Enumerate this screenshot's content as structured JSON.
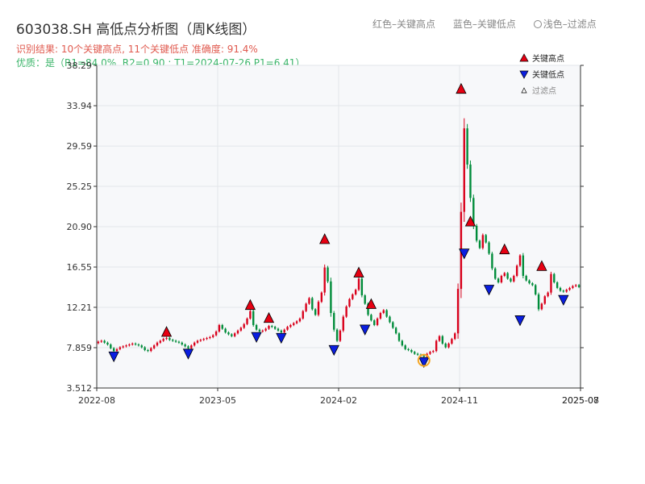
{
  "title": "603038.SH 高低点分析图（周K线图）",
  "subtitle1": "识别结果: 10个关键高点, 11个关键低点  准确度: 91.4%",
  "subtitle2": "优质：是（R1=84.0%, R2=0.90 ; T1=2024-07-26 P1=6.41）",
  "top_legend": {
    "red_label": "红色–关键高点",
    "blue_label": "蓝色–关键低点",
    "light_label": "浅色–过滤点"
  },
  "colors": {
    "up": "#d9001b",
    "down": "#008c3a",
    "high_marker": "#e60012",
    "low_marker": "#0a1ee0",
    "filtered": "#f5a623",
    "plot_bg": "#f7f8fa",
    "grid": "#e3e6ea"
  },
  "chart_data": {
    "type": "candlestick",
    "ylim": [
      3.512,
      38.29
    ],
    "yticks": [
      "3.512",
      "7.859",
      "12.21",
      "16.55",
      "20.90",
      "25.25",
      "29.59",
      "33.94",
      "38.29"
    ],
    "xlim_weeks": [
      0,
      156
    ],
    "xticks": [
      {
        "week": 0,
        "label": "2022-08"
      },
      {
        "week": 39,
        "label": "2023-05"
      },
      {
        "week": 78,
        "label": "2024-02"
      },
      {
        "week": 117,
        "label": "2024-11"
      },
      {
        "week": 156,
        "label": "2025-07"
      },
      {
        "week": 156,
        "label": "2025-08"
      }
    ],
    "legend": [
      {
        "label": "关键高点",
        "marker": "up-triangle"
      },
      {
        "label": "关键低点",
        "marker": "down-triangle"
      },
      {
        "label": "过滤点",
        "marker": "small-triangle"
      }
    ],
    "closes": [
      8.5,
      8.6,
      8.4,
      8.2,
      7.8,
      7.5,
      7.7,
      7.9,
      8.0,
      8.1,
      8.2,
      8.3,
      8.2,
      8.1,
      7.9,
      7.6,
      7.5,
      7.8,
      8.1,
      8.4,
      8.6,
      8.8,
      8.9,
      8.7,
      8.6,
      8.5,
      8.4,
      8.2,
      8.0,
      7.8,
      8.1,
      8.4,
      8.6,
      8.7,
      8.8,
      8.9,
      9.0,
      9.2,
      9.6,
      10.3,
      9.9,
      9.5,
      9.3,
      9.1,
      9.4,
      9.7,
      10.0,
      10.4,
      11.0,
      11.8,
      10.3,
      9.8,
      9.6,
      9.7,
      9.9,
      10.2,
      10.1,
      9.9,
      9.7,
      9.5,
      9.8,
      10.1,
      10.3,
      10.5,
      10.7,
      11.0,
      11.8,
      12.6,
      13.2,
      12.0,
      11.4,
      12.8,
      13.8,
      16.5,
      15.0,
      11.6,
      9.8,
      8.6,
      9.7,
      11.2,
      12.3,
      13.1,
      13.6,
      14.1,
      15.3,
      13.5,
      12.6,
      11.4,
      10.8,
      10.3,
      11.0,
      11.6,
      11.9,
      11.2,
      10.6,
      10.0,
      9.4,
      8.6,
      8.1,
      7.7,
      7.6,
      7.4,
      7.2,
      7.1,
      7.0,
      6.9,
      7.2,
      7.4,
      7.5,
      8.6,
      9.1,
      8.3,
      7.9,
      8.3,
      8.8,
      9.4,
      14.2,
      22.5,
      31.5,
      27.6,
      24.0,
      21.0,
      19.4,
      18.6,
      20.0,
      19.2,
      18.0,
      16.4,
      15.3,
      14.9,
      15.6,
      15.9,
      15.3,
      15.0,
      15.6,
      16.7,
      17.8,
      15.6,
      15.1,
      14.8,
      14.6,
      13.6,
      12.0,
      12.6,
      13.4,
      13.8,
      15.8,
      14.9,
      14.3,
      14.0,
      13.9,
      14.1,
      14.3,
      14.5,
      14.6,
      14.4
    ],
    "key_highs": [
      {
        "week": 22,
        "value": 8.9
      },
      {
        "week": 49,
        "value": 11.8
      },
      {
        "week": 55,
        "value": 10.4
      },
      {
        "week": 73,
        "value": 18.9
      },
      {
        "week": 84,
        "value": 15.3
      },
      {
        "week": 88,
        "value": 11.9
      },
      {
        "week": 117,
        "value": 35.1
      },
      {
        "week": 120,
        "value": 20.8
      },
      {
        "week": 131,
        "value": 17.8
      },
      {
        "week": 143,
        "value": 16.0
      }
    ],
    "key_lows": [
      {
        "week": 5,
        "value": 7.4
      },
      {
        "week": 29,
        "value": 7.7
      },
      {
        "week": 51,
        "value": 9.5
      },
      {
        "week": 59,
        "value": 9.4
      },
      {
        "week": 76,
        "value": 8.1
      },
      {
        "week": 86,
        "value": 10.3
      },
      {
        "week": 105,
        "value": 6.8
      },
      {
        "week": 118,
        "value": 18.5
      },
      {
        "week": 126,
        "value": 14.6
      },
      {
        "week": 136,
        "value": 11.3
      },
      {
        "week": 150,
        "value": 13.5
      }
    ],
    "filtered_points": [
      {
        "week": 105,
        "value": 6.5
      }
    ]
  }
}
